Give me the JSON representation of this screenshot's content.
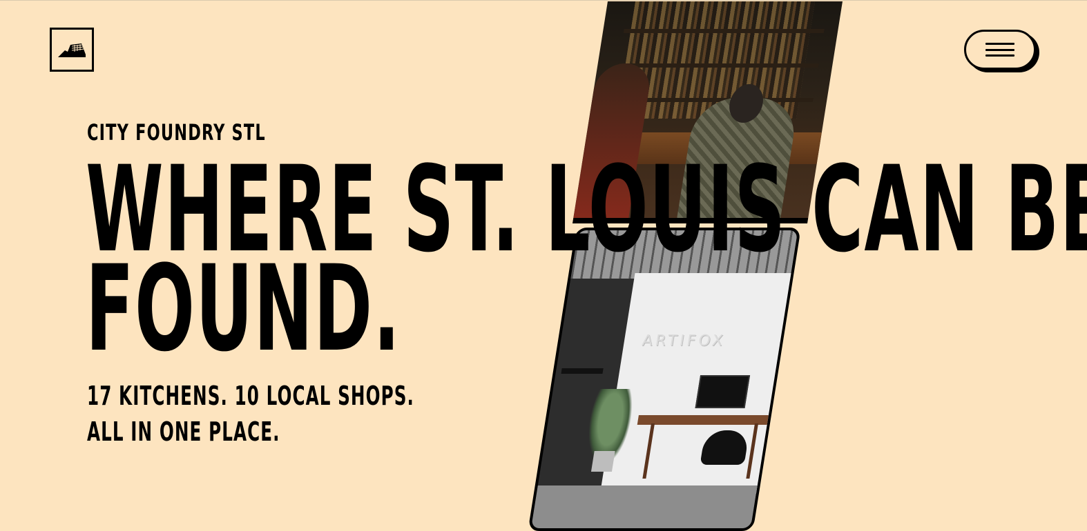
{
  "brand": {
    "logo_icon": "foundry-building-icon",
    "eyebrow": "CITY FOUNDRY STL"
  },
  "header": {
    "menu_icon": "hamburger-menu-icon"
  },
  "hero": {
    "headline_line1": "WHERE ST. LOUIS CAN BE",
    "headline_line2": "FOUND.",
    "tagline_line1": "17 KITCHENS. 10 LOCAL SHOPS.",
    "tagline_line2": "ALL IN ONE PLACE."
  },
  "photos": {
    "office_sign": "ARTIFOX"
  },
  "colors": {
    "background": "#fde4bf",
    "ink": "#000000"
  }
}
